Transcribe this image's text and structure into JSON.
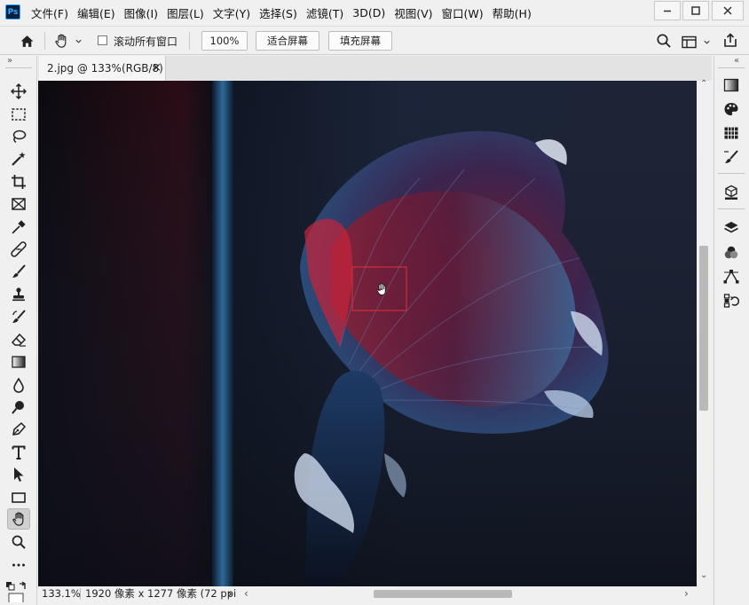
{
  "app": {
    "logo_text": "Ps"
  },
  "menu": [
    "文件(F)",
    "编辑(E)",
    "图像(I)",
    "图层(L)",
    "文字(Y)",
    "选择(S)",
    "滤镜(T)",
    "3D(D)",
    "视图(V)",
    "窗口(W)",
    "帮助(H)"
  ],
  "options": {
    "scroll_all_label": "滚动所有窗口",
    "scroll_all_checked": false,
    "zoom_100_label": "100%",
    "fit_screen_label": "适合屏幕",
    "fill_screen_label": "填充屏幕"
  },
  "document": {
    "tab_title": "2.jpg @ 133%(RGB/8)",
    "close_glyph": "×"
  },
  "status": {
    "zoom": "133.1%",
    "dimensions": "1920 像素 x 1277 像素 (72 ppi)",
    "arrow": "›"
  },
  "scrollbars": {
    "left_arrow": "‹",
    "right_arrow": "›",
    "up_arrow": "⌃",
    "down_arrow": "⌄"
  },
  "panel_collapse": {
    "left": "»",
    "right": "«"
  },
  "tools": [
    "move-tool-icon",
    "marquee-tool-icon",
    "lasso-tool-icon",
    "magic-wand-tool-icon",
    "crop-tool-icon",
    "frame-tool-icon",
    "eyedropper-tool-icon",
    "healing-brush-tool-icon",
    "brush-tool-icon",
    "clone-stamp-tool-icon",
    "history-brush-tool-icon",
    "eraser-tool-icon",
    "gradient-tool-icon",
    "blur-tool-icon",
    "dodge-tool-icon",
    "pen-tool-icon",
    "type-tool-icon",
    "path-selection-tool-icon",
    "rectangle-tool-icon",
    "hand-tool-icon",
    "zoom-tool-icon",
    "more-tools-icon"
  ],
  "right_panels": [
    "gradients-panel-icon",
    "color-panel-icon",
    "swatches-panel-icon",
    "brushes-panel-icon",
    "3d-panel-icon",
    "layers-panel-icon",
    "channels-panel-icon",
    "paths-panel-icon",
    "history-panel-icon"
  ],
  "colors": {
    "selection_box": "#e0303a",
    "accent": "#31a8ff"
  }
}
